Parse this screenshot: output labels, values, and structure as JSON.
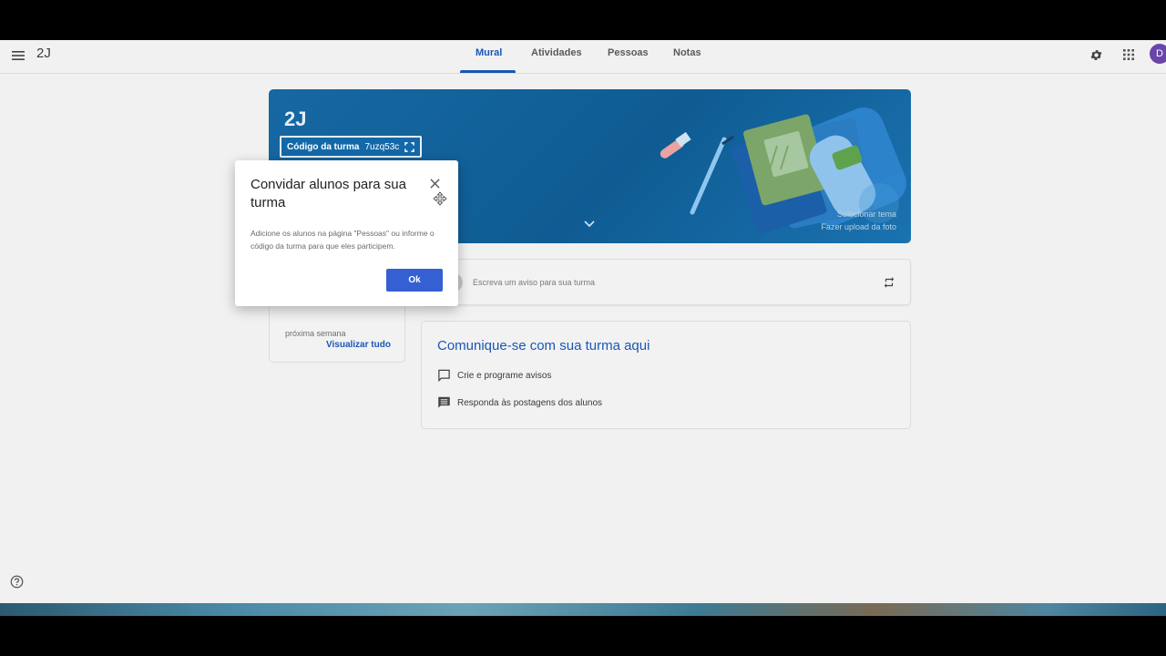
{
  "header": {
    "class_name": "2J",
    "tabs": [
      {
        "label": "Mural",
        "active": true
      },
      {
        "label": "Atividades",
        "active": false
      },
      {
        "label": "Pessoas",
        "active": false
      },
      {
        "label": "Notas",
        "active": false
      }
    ],
    "avatar_initial": "D"
  },
  "banner": {
    "title": "2J",
    "class_code_label": "Código da turma",
    "class_code_value": "7uzq53c",
    "select_theme": "Selecionar tema",
    "upload_photo": "Fazer upload da foto"
  },
  "post_box": {
    "placeholder": "Escreva um aviso para sua turma"
  },
  "upcoming": {
    "text": "próxima semana",
    "view_all": "Visualizar tudo"
  },
  "communicate": {
    "title": "Comunique-se com sua turma aqui",
    "items": [
      {
        "label": "Crie e programe avisos",
        "icon": "chat-bubble-icon"
      },
      {
        "label": "Responda às postagens dos alunos",
        "icon": "comment-list-icon"
      }
    ]
  },
  "dialog": {
    "title": "Convidar alunos para sua turma",
    "body": "Adicione os alunos na página \"Pessoas\" ou informe o código da turma para que eles participem.",
    "ok_label": "Ok"
  },
  "colors": {
    "accent": "#1a56b6",
    "banner": "#0f5c93",
    "ok_button": "#3560d4",
    "avatar": "#6a45a8"
  }
}
